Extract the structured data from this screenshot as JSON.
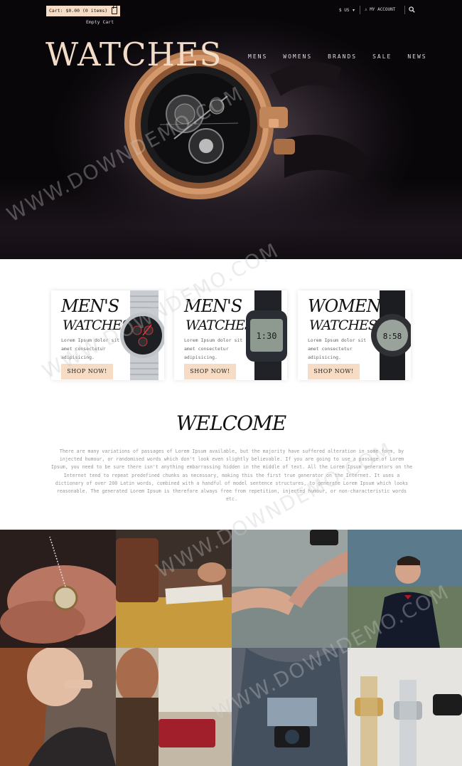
{
  "header": {
    "cart_label": "Cart: $0.00 (0 items)",
    "empty_cart": "Empty Cart",
    "currency": "$ US",
    "account": "MY ACCOUNT"
  },
  "brand": {
    "logo": "WATCHES"
  },
  "nav": {
    "items": [
      "MENS",
      "WOMENS",
      "BRANDS",
      "SALE",
      "NEWS"
    ]
  },
  "cards": [
    {
      "title1": "MEN'S",
      "title2": "WATCHES",
      "desc": "Lorem Ipsum dolor sit amet consectetur adipisicing.",
      "button": "SHOP NOW!"
    },
    {
      "title1": "MEN'S",
      "title2": "WATCHES",
      "desc": "Lorem Ipsum dolor sit amet consectetur adipisicing.",
      "button": "SHOP NOW!"
    },
    {
      "title1": "WOMEN'S",
      "title2": "WATCHES",
      "desc": "Lorem Ipsum dolor sit amet consectetur adipisicing.",
      "button": "SHOP NOW!"
    }
  ],
  "welcome": {
    "title": "WELCOME",
    "text": "There are many variations of passages of Lorem Ipsum available, but the majority have suffered alteration in some form, by injected humour, or randomised words which don't look even slightly believable. If you are going to use a passage of Lorem Ipsum, you need to be sure there isn't anything embarrassing hidden in the middle of text. All the Lorem Ipsum generators on the Internet tend to repeat predefined chunks as necessary, making this the first true generator on the Internet. It uses a dictionary of over 200 Latin words, combined with a handful of model sentence structures, to generate Lorem Ipsum which looks reasonable. The generated Lorem Ipsum is therefore always free from repetition, injected humour, or non-characteristic words etc."
  },
  "watermark": "WWW.DOWNDEMO.COM",
  "colors": {
    "accent": "#f6dcc4",
    "hero_dark": "#0d0a0e",
    "gold": "#c8865a"
  }
}
